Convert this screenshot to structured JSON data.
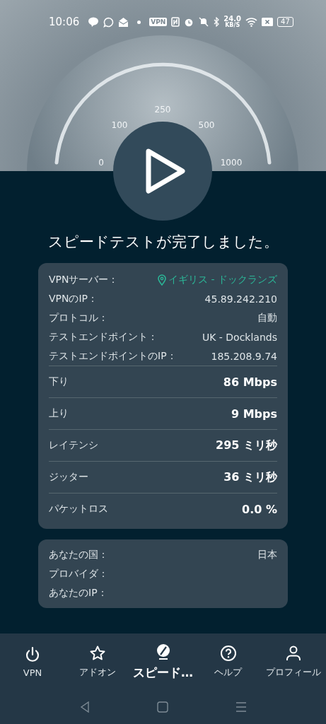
{
  "status_bar": {
    "time": "10:06",
    "vpn_badge": "VPN",
    "speed": "24.0",
    "speed_unit": "KB/S",
    "battery": "47"
  },
  "gauge": {
    "ticks": [
      "0",
      "100",
      "250",
      "500",
      "1000"
    ]
  },
  "title": "スピードテストが完了しました。",
  "connection": [
    {
      "label": "VPNサーバー：",
      "value": "イギリス - ドックランズ",
      "kind": "location"
    },
    {
      "label": "VPNのIP：",
      "value": "45.89.242.210",
      "kind": "plain"
    },
    {
      "label": "プロトコル：",
      "value": "自動",
      "kind": "plain"
    },
    {
      "label": "テストエンドポイント：",
      "value": "UK - Docklands",
      "kind": "plain"
    },
    {
      "label": "テストエンドポイントのIP：",
      "value": "185.208.9.74",
      "kind": "plain"
    }
  ],
  "results": [
    {
      "label": "下り",
      "value": "86 Mbps"
    },
    {
      "label": "上り",
      "value": "9 Mbps"
    },
    {
      "label": "レイテンシ",
      "value": "295 ミリ秒"
    },
    {
      "label": "ジッター",
      "value": "36 ミリ秒"
    },
    {
      "label": "パケットロス",
      "value": "0.0 %"
    }
  ],
  "user_info": [
    {
      "label": "あなたの国：",
      "value": "日本"
    },
    {
      "label": "プロバイダ："
    },
    {
      "label": "あなたのIP："
    }
  ],
  "nav": [
    {
      "label": "VPN",
      "kind": "power",
      "selected": false
    },
    {
      "label": "アドオン",
      "kind": "star",
      "selected": false
    },
    {
      "label": "スピード…",
      "kind": "speed",
      "selected": true
    },
    {
      "label": "ヘルプ",
      "kind": "help",
      "selected": false
    },
    {
      "label": "プロフィール",
      "kind": "profile",
      "selected": false
    }
  ]
}
